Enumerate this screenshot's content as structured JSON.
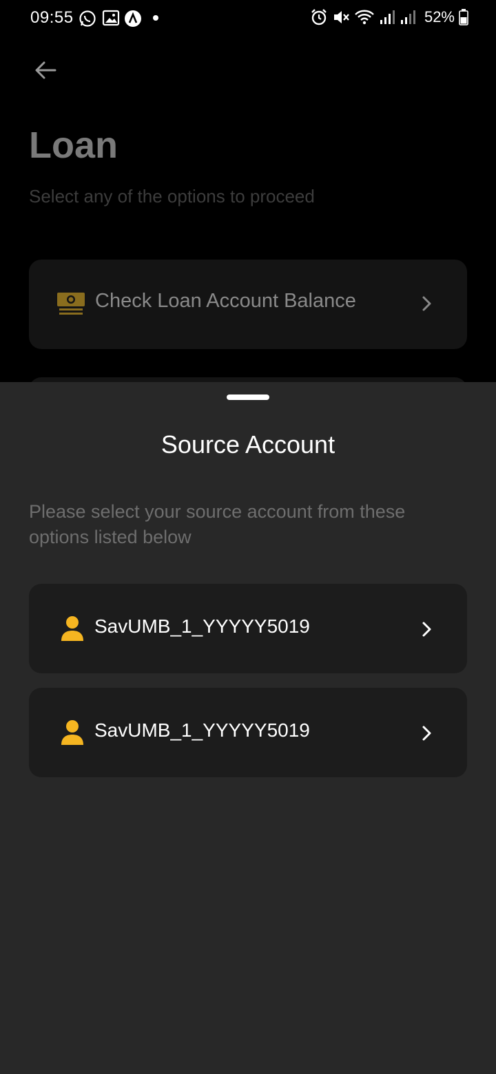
{
  "status_bar": {
    "time": "09:55",
    "battery": "52%"
  },
  "page": {
    "title": "Loan",
    "subtitle": "Select any of the options to proceed",
    "options": [
      {
        "label": "Check Loan Account Balance",
        "icon": "money-stack-icon"
      }
    ]
  },
  "sheet": {
    "title": "Source Account",
    "description": "Please select your source account from these options listed below",
    "accounts": [
      {
        "label": "SavUMB_1_YYYYY5019",
        "icon": "person-icon"
      },
      {
        "label": "SavUMB_1_YYYYY5019",
        "icon": "person-icon"
      }
    ]
  },
  "colors": {
    "accent": "#F5B521",
    "sheet_bg": "#282828",
    "card_bg": "#1C1C1C"
  }
}
